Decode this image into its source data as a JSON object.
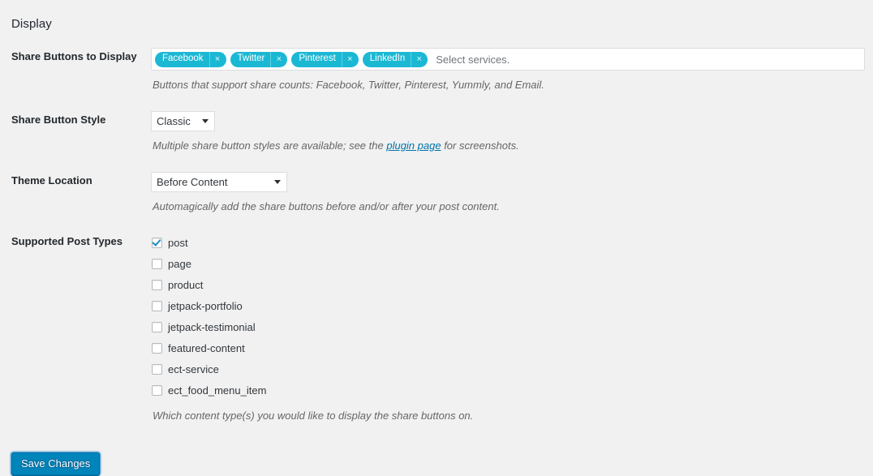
{
  "page": {
    "heading": "Display"
  },
  "rows": {
    "share_buttons": {
      "label": "Share Buttons to Display",
      "placeholder": "Select services.",
      "tags": [
        {
          "label": "Facebook",
          "remove": "×"
        },
        {
          "label": "Twitter",
          "remove": "×"
        },
        {
          "label": "Pinterest",
          "remove": "×"
        },
        {
          "label": "LinkedIn",
          "remove": "×"
        }
      ],
      "description": "Buttons that support share counts: Facebook, Twitter, Pinterest, Yummly, and Email."
    },
    "share_button_style": {
      "label": "Share Button Style",
      "selected": "Classic",
      "options": [
        "Classic"
      ],
      "description_before": "Multiple share button styles are available; see the ",
      "description_link": "plugin page",
      "description_after": " for screenshots."
    },
    "theme_location": {
      "label": "Theme Location",
      "selected": "Before Content",
      "options": [
        "Before Content"
      ],
      "description": "Automagically add the share buttons before and/or after your post content."
    },
    "supported_post_types": {
      "label": "Supported Post Types",
      "items": [
        {
          "label": "post",
          "checked": true
        },
        {
          "label": "page",
          "checked": false
        },
        {
          "label": "product",
          "checked": false
        },
        {
          "label": "jetpack-portfolio",
          "checked": false
        },
        {
          "label": "jetpack-testimonial",
          "checked": false
        },
        {
          "label": "featured-content",
          "checked": false
        },
        {
          "label": "ect-service",
          "checked": false
        },
        {
          "label": "ect_food_menu_item",
          "checked": false
        }
      ],
      "description": "Which content type(s) you would like to display the share buttons on."
    }
  },
  "submit": {
    "save_label": "Save Changes"
  },
  "colors": {
    "tag_background": "#1bb8d4",
    "primary_button": "#0085ba",
    "link": "#0073aa",
    "checkbox_check": "#1e8cbe",
    "page_background": "#f1f1f1"
  }
}
